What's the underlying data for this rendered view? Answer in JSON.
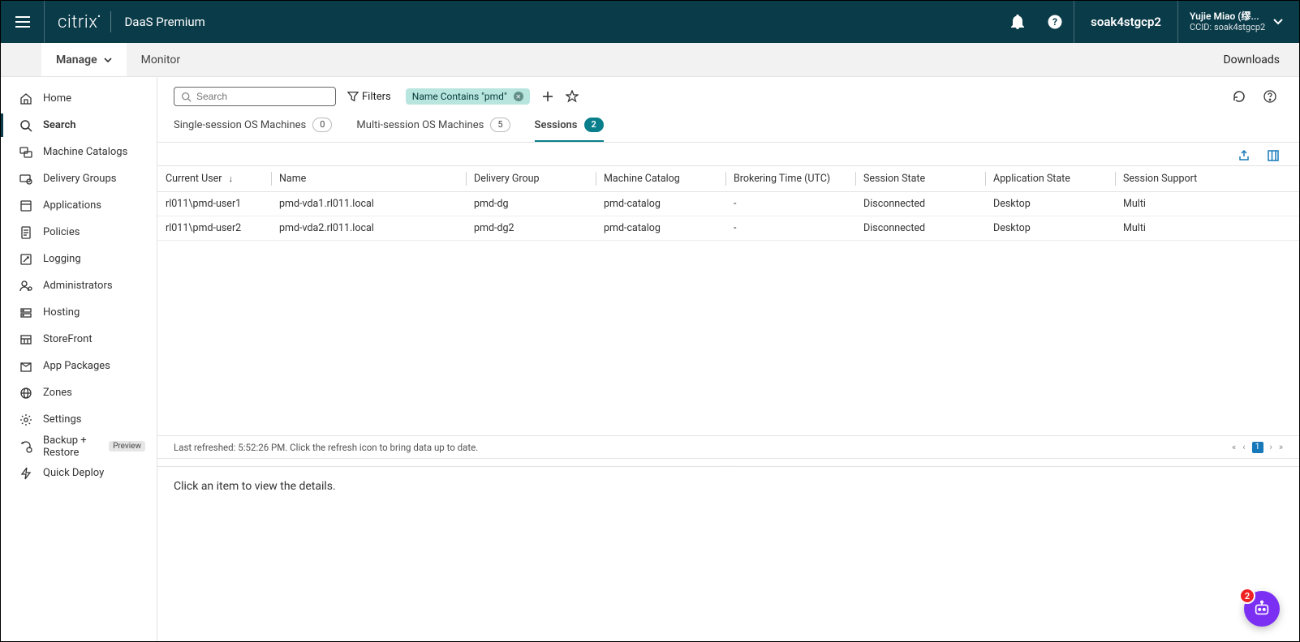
{
  "brand": {
    "logo": "citrix",
    "title": "DaaS Premium"
  },
  "tenant": "soak4stgcp2",
  "user": {
    "name": "Yujie Miao  (缪...",
    "ccid_label": "CCID:",
    "ccid": "soak4stgcp2"
  },
  "nav": {
    "manage": "Manage",
    "monitor": "Monitor",
    "downloads": "Downloads"
  },
  "sidebar": {
    "items": [
      {
        "key": "home",
        "label": "Home"
      },
      {
        "key": "search",
        "label": "Search"
      },
      {
        "key": "machine-catalogs",
        "label": "Machine Catalogs"
      },
      {
        "key": "delivery-groups",
        "label": "Delivery Groups"
      },
      {
        "key": "applications",
        "label": "Applications"
      },
      {
        "key": "policies",
        "label": "Policies"
      },
      {
        "key": "logging",
        "label": "Logging"
      },
      {
        "key": "administrators",
        "label": "Administrators"
      },
      {
        "key": "hosting",
        "label": "Hosting"
      },
      {
        "key": "storefront",
        "label": "StoreFront"
      },
      {
        "key": "app-packages",
        "label": "App Packages"
      },
      {
        "key": "zones",
        "label": "Zones"
      },
      {
        "key": "settings",
        "label": "Settings"
      },
      {
        "key": "backup-restore",
        "label": "Backup + Restore",
        "badge": "Preview"
      },
      {
        "key": "quick-deploy",
        "label": "Quick Deploy"
      }
    ]
  },
  "toolbar": {
    "search_placeholder": "Search",
    "filters_label": "Filters",
    "chip_label": "Name Contains \"pmd\""
  },
  "tabs": {
    "single": {
      "label": "Single-session OS Machines",
      "count": "0"
    },
    "multi": {
      "label": "Multi-session OS Machines",
      "count": "5"
    },
    "sessions": {
      "label": "Sessions",
      "count": "2"
    }
  },
  "columns": {
    "current_user": "Current User",
    "name": "Name",
    "delivery_group": "Delivery Group",
    "machine_catalog": "Machine Catalog",
    "brokering_time": "Brokering Time (UTC)",
    "session_state": "Session State",
    "application_state": "Application State",
    "session_support": "Session Support"
  },
  "rows": [
    {
      "user": "rl011\\pmd-user1",
      "name": "pmd-vda1.rl011.local",
      "dg": "pmd-dg",
      "mc": "pmd-catalog",
      "bt": "-",
      "ss": "Disconnected",
      "as": "Desktop",
      "sup": "Multi"
    },
    {
      "user": "rl011\\pmd-user2",
      "name": "pmd-vda2.rl011.local",
      "dg": "pmd-dg2",
      "mc": "pmd-catalog",
      "bt": "-",
      "ss": "Disconnected",
      "as": "Desktop",
      "sup": "Multi"
    }
  ],
  "status": {
    "text": "Last refreshed: 5:52:26 PM. Click the refresh icon to bring data up to date.",
    "page": "1"
  },
  "detail_hint": "Click an item to view the details.",
  "splitter_glyph": "……",
  "fab_badge": "2"
}
